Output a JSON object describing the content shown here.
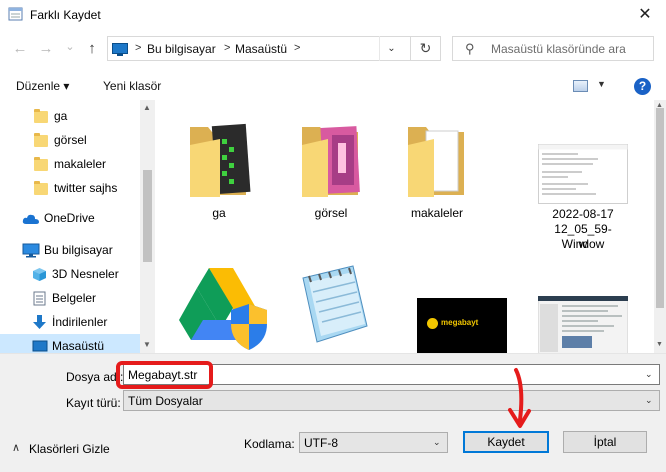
{
  "window": {
    "title": "Farklı Kaydet",
    "close_glyph": "✕"
  },
  "nav": {
    "back_glyph": "←",
    "forward_glyph": "→",
    "recent_glyph": "⌄",
    "up_glyph": "↑",
    "breadcrumb": [
      "Bu bilgisayar",
      "Masaüstü"
    ],
    "separator": ">",
    "dropdown_glyph": "⌄",
    "refresh_glyph": "↻",
    "search_glyph": "⚲",
    "search_placeholder": "Masaüstü klasöründe ara"
  },
  "toolbar": {
    "organize": "Düzenle ▾",
    "new_folder": "Yeni klasör",
    "view_drop": "▼",
    "help": "?"
  },
  "sidebar": {
    "items": [
      {
        "label": "ga",
        "icon": "folder-icon"
      },
      {
        "label": "görsel",
        "icon": "folder-icon"
      },
      {
        "label": "makaleler",
        "icon": "folder-icon"
      },
      {
        "label": "twitter sajhs",
        "icon": "folder-icon"
      },
      {
        "label": "OneDrive",
        "icon": "cloud-icon"
      },
      {
        "label": "Bu bilgisayar",
        "icon": "computer-icon"
      },
      {
        "label": "3D Nesneler",
        "icon": "cube-icon"
      },
      {
        "label": "Belgeler",
        "icon": "document-icon"
      },
      {
        "label": "İndirilenler",
        "icon": "download-icon"
      },
      {
        "label": "Masaüstü",
        "icon": "desktop-icon"
      }
    ],
    "scroll_up": "▲",
    "scroll_down": "▼"
  },
  "content": {
    "tiles": [
      {
        "label": "ga",
        "icon": "folder-icon"
      },
      {
        "label": "görsel",
        "icon": "folder-icon"
      },
      {
        "label": "makaleler",
        "icon": "folder-icon"
      },
      {
        "label": "2022-08-17 12_05_59-Window",
        "icon": "text-file-thumbnail"
      },
      {
        "label": "",
        "icon": "google-drive-icon"
      },
      {
        "label": "",
        "icon": "notepad-icon"
      },
      {
        "label": "",
        "icon": "image-thumbnail"
      },
      {
        "label": "",
        "icon": "screenshot-thumbnail"
      }
    ],
    "megabayt_logo_text": "megabayt",
    "scroll_up": "▲",
    "scroll_down": "▼"
  },
  "form": {
    "filename_label": "Dosya adı:",
    "filename_value": "Megabayt.str",
    "filetype_label": "Kayıt türü:",
    "filetype_value": "Tüm Dosyalar",
    "hide_folders": "Klasörleri Gizle",
    "encoding_label": "Kodlama:",
    "encoding_value": "UTF-8",
    "save": "Kaydet",
    "cancel": "İptal",
    "chevron": "⌄",
    "collapse_glyph": "∧"
  },
  "colors": {
    "accent": "#0078d7",
    "annotation": "#e51b1b",
    "selection": "#cce8ff"
  }
}
